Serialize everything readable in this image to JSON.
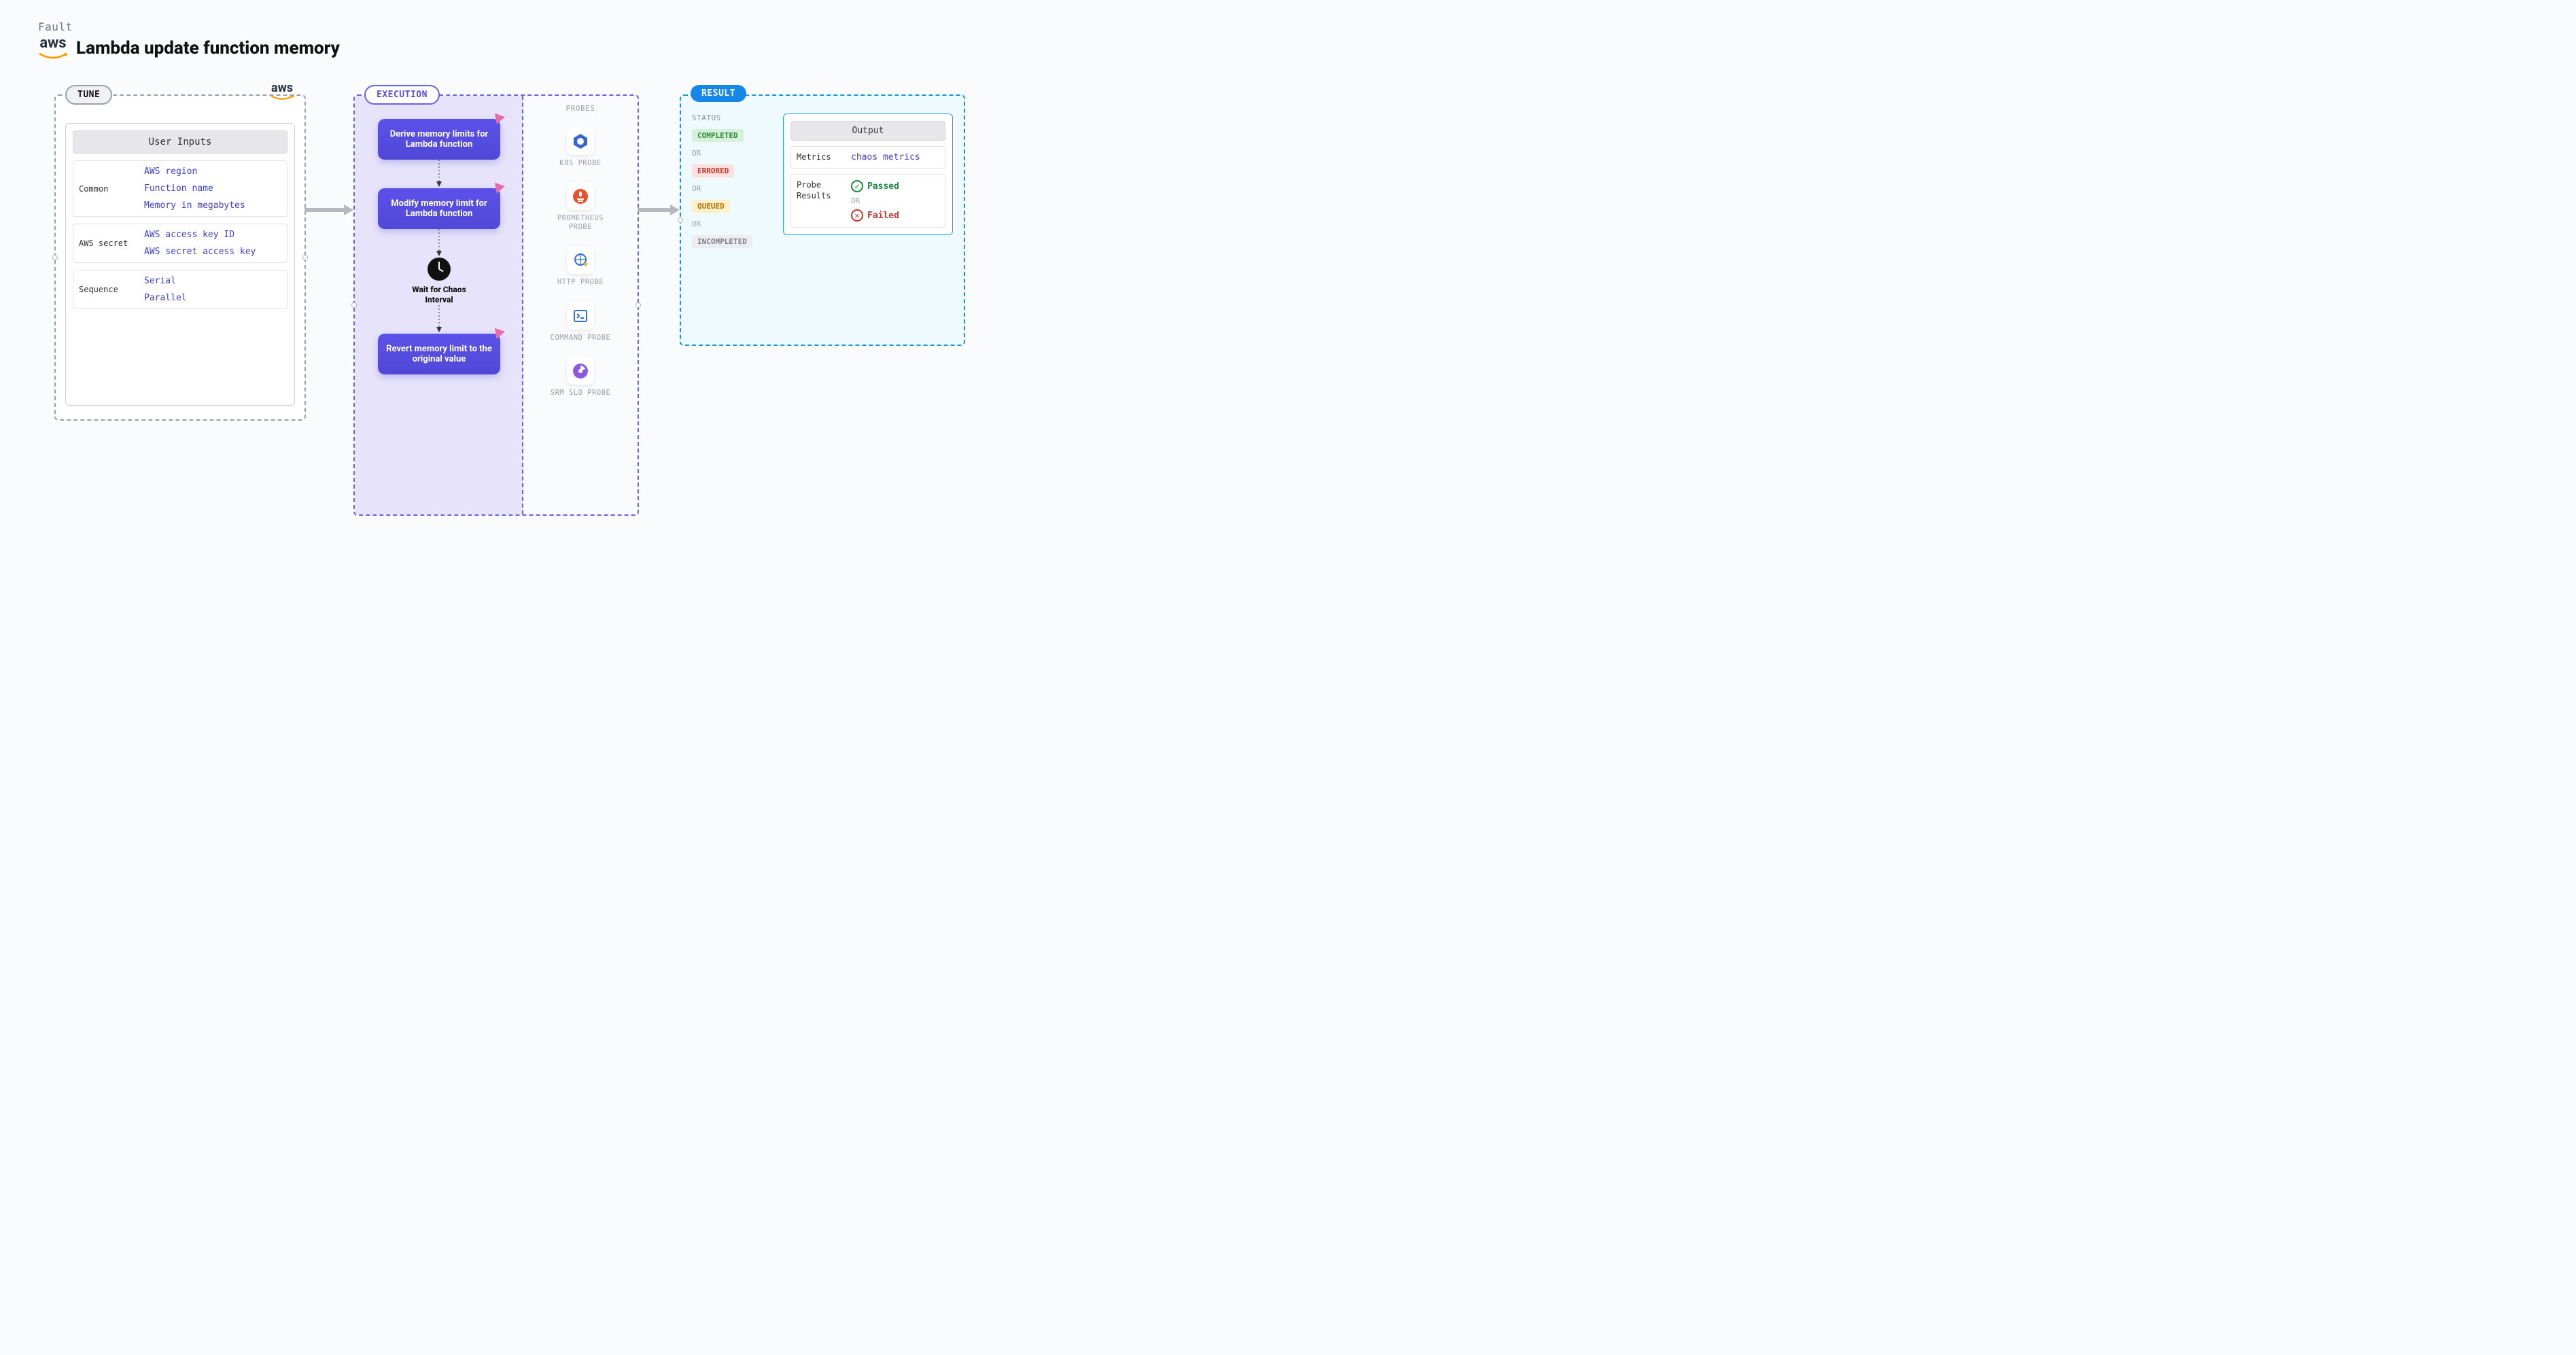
{
  "header": {
    "fault_label": "Fault",
    "title": "Lambda update function memory",
    "brand": "aws"
  },
  "tune": {
    "badge": "TUNE",
    "aws_mark": "aws",
    "inputs_title": "User Inputs",
    "groups": [
      {
        "label": "Common",
        "values": [
          "AWS region",
          "Function name",
          "Memory in megabytes"
        ]
      },
      {
        "label": "AWS secret",
        "values": [
          "AWS access key ID",
          "AWS secret access key"
        ]
      },
      {
        "label": "Sequence",
        "values": [
          "Serial",
          "Parallel"
        ]
      }
    ]
  },
  "execution": {
    "badge": "EXECUTION",
    "steps": [
      "Derive memory limits for Lambda function",
      "Modify memory limit for Lambda function",
      "Revert memory limit to the original value"
    ],
    "wait_label": "Wait for Chaos Interval",
    "probes_title": "PROBES",
    "probes": [
      "K8S PROBE",
      "PROMETHEUS PROBE",
      "HTTP PROBE",
      "COMMAND PROBE",
      "SRM SLO PROBE"
    ]
  },
  "result": {
    "badge": "RESULT",
    "status_title": "STATUS",
    "or": "OR",
    "statuses": [
      {
        "label": "COMPLETED",
        "cls": "b-green"
      },
      {
        "label": "ERRORED",
        "cls": "b-red"
      },
      {
        "label": "QUEUED",
        "cls": "b-yellow"
      },
      {
        "label": "INCOMPLETED",
        "cls": "b-grey"
      }
    ],
    "output_title": "Output",
    "metrics_label": "Metrics",
    "metrics_value": "chaos metrics",
    "probe_results_label": "Probe Results",
    "passed": "Passed",
    "failed": "Failed"
  }
}
